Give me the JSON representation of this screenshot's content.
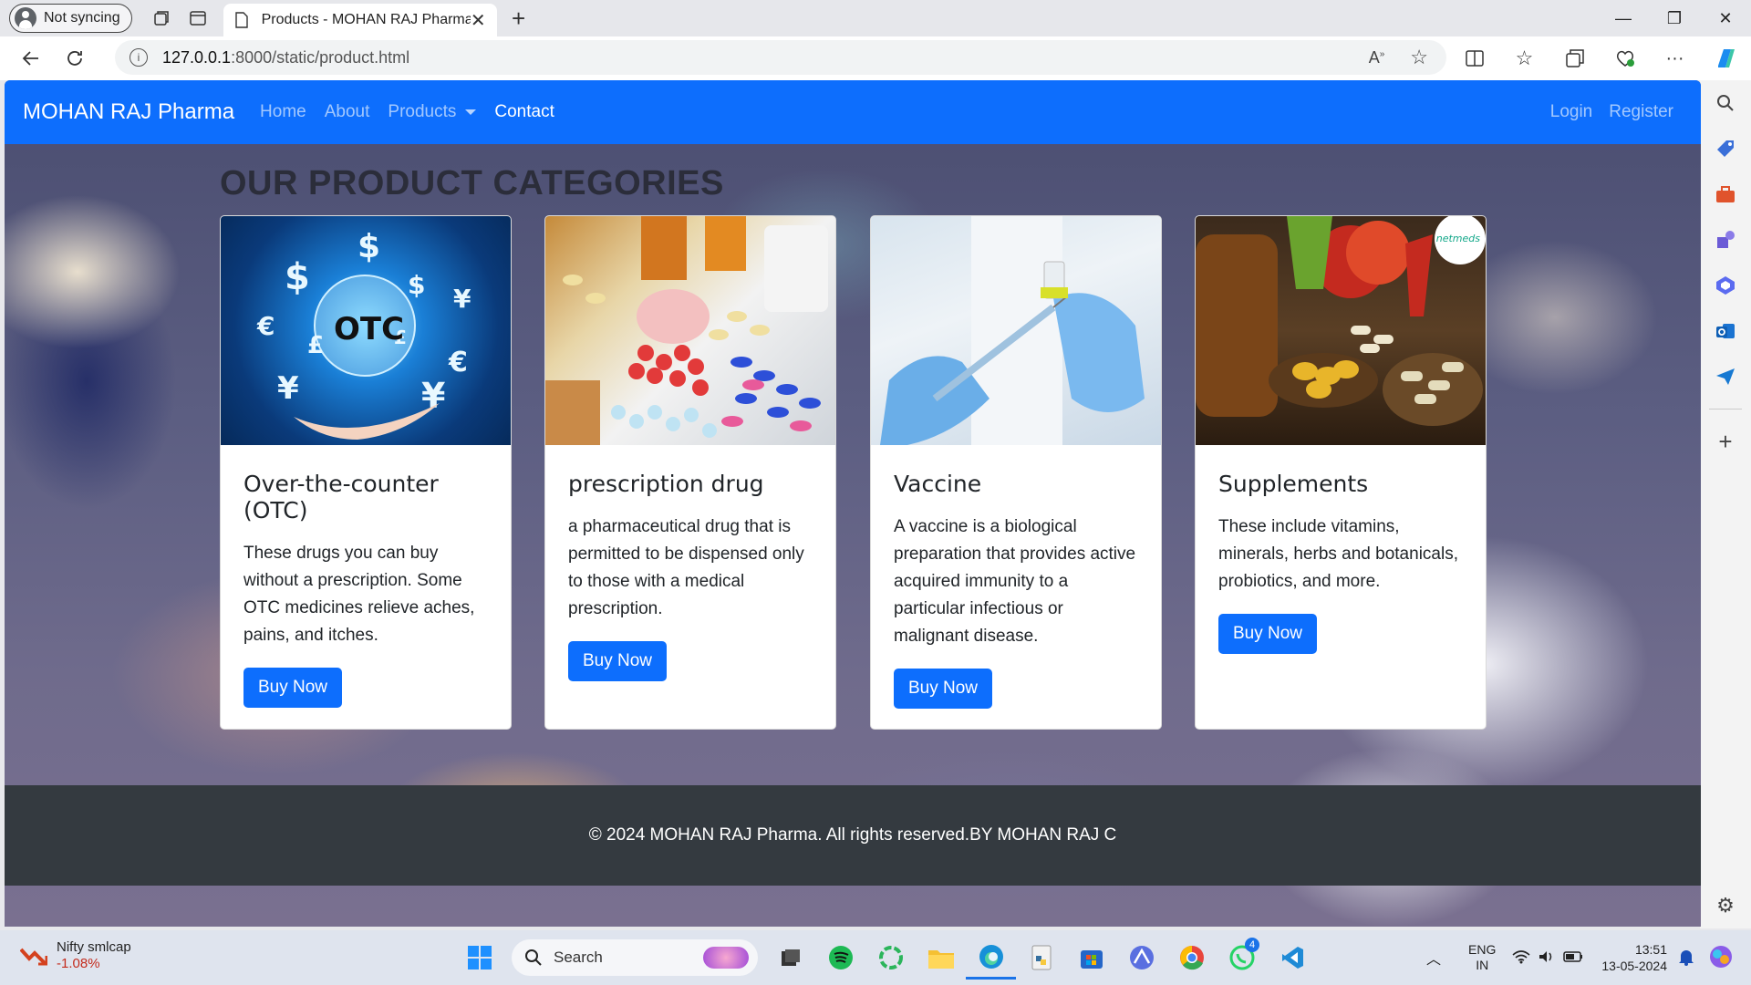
{
  "browser": {
    "profile_label": "Not syncing",
    "tab_title": "Products - MOHAN RAJ Pharma",
    "url_host": "127.0.0.1",
    "url_path": ":8000/static/product.html"
  },
  "site": {
    "brand": "MOHAN RAJ Pharma",
    "nav": {
      "home": "Home",
      "about": "About",
      "products": "Products",
      "contact": "Contact",
      "login": "Login",
      "register": "Register"
    },
    "section_title": "OUR PRODUCT CATEGORIES",
    "cards": [
      {
        "title": "Over-the-counter (OTC)",
        "text": "These drugs you can buy without a prescription. Some OTC medicines relieve aches, pains, and itches.",
        "button": "Buy Now",
        "image_label": "OTC"
      },
      {
        "title": "prescription drug",
        "text": "a pharmaceutical drug that is permitted to be dispensed only to those with a medical prescription.",
        "button": "Buy Now"
      },
      {
        "title": "Vaccine",
        "text": "A vaccine is a biological preparation that provides active acquired immunity to a particular infectious or malignant disease.",
        "button": "Buy Now"
      },
      {
        "title": "Supplements",
        "text": "These include vitamins, minerals, herbs and botanicals, probiotics, and more.",
        "button": "Buy Now",
        "image_badge": "netmeds"
      }
    ],
    "footer": "© 2024 MOHAN RAJ Pharma. All rights reserved.BY MOHAN RAJ C"
  },
  "taskbar": {
    "widget_title": "Nifty smlcap",
    "widget_value": "-1.08%",
    "search_placeholder": "Search",
    "lang_line1": "ENG",
    "lang_line2": "IN",
    "time": "13:51",
    "date": "13-05-2024",
    "whatsapp_badge": "4"
  },
  "colors": {
    "navbar": "#0d6efd",
    "button": "#0d6efd",
    "footer": "#343a40"
  }
}
